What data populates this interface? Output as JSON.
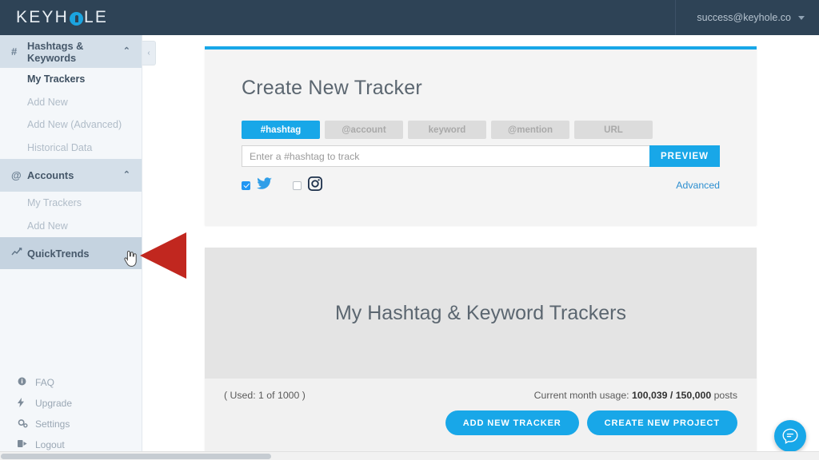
{
  "topbar": {
    "brand_before": "KEYH",
    "brand_after": "LE",
    "account_email": "success@keyhole.co"
  },
  "sidebar": {
    "groups": [
      {
        "label": "Hashtags & Keywords",
        "icon": "hashtag-icon",
        "icon_glyph": "#",
        "chevron": "⌃",
        "items": [
          {
            "label": "My Trackers",
            "active": true
          },
          {
            "label": "Add New",
            "active": false
          },
          {
            "label": "Add New (Advanced)",
            "active": false
          },
          {
            "label": "Historical Data",
            "active": false
          }
        ]
      },
      {
        "label": "Accounts",
        "icon": "at-icon",
        "icon_glyph": "@",
        "chevron": "⌃",
        "items": [
          {
            "label": "My Trackers",
            "active": false
          },
          {
            "label": "Add New",
            "active": false
          }
        ]
      }
    ],
    "quicktrends": {
      "label": "QuickTrends",
      "icon": "chart-line-icon"
    },
    "collapse_label": "‹",
    "bottom_items": [
      {
        "label": "FAQ",
        "icon": "info-circle-icon"
      },
      {
        "label": "Upgrade",
        "icon": "bolt-icon"
      },
      {
        "label": "Settings",
        "icon": "gears-icon"
      },
      {
        "label": "Logout",
        "icon": "sign-out-icon"
      }
    ]
  },
  "create_tracker": {
    "title": "Create New Tracker",
    "tabs": [
      {
        "label": "#hashtag",
        "active": true
      },
      {
        "label": "@account",
        "active": false
      },
      {
        "label": "keyword",
        "active": false
      },
      {
        "label": "@mention",
        "active": false
      },
      {
        "label": "URL",
        "active": false
      }
    ],
    "input_value": "",
    "input_placeholder": "Enter a #hashtag to track",
    "preview_label": "PREVIEW",
    "advanced_label": "Advanced",
    "networks": [
      {
        "name": "twitter",
        "checked": true
      },
      {
        "name": "instagram",
        "checked": false
      }
    ]
  },
  "trackers": {
    "hero_title": "My Hashtag & Keyword Trackers",
    "used_text": "( Used: 1 of 1000 )",
    "usage_prefix": "Current month usage:",
    "usage_value": "100,039 / 150,000",
    "usage_suffix": "posts",
    "add_tracker_label": "ADD NEW TRACKER",
    "create_project_label": "CREATE NEW PROJECT"
  },
  "overlays": {
    "chat_icon": "chat-bubble-icon",
    "arrow_color": "#c1271f"
  },
  "colors": {
    "brand_dark": "#2e4356",
    "accent_blue": "#18a7e8",
    "sidebar_bg": "#f4f7fa",
    "group_header_bg": "#d4dfe9",
    "selected_bg": "#c5d3e0"
  }
}
